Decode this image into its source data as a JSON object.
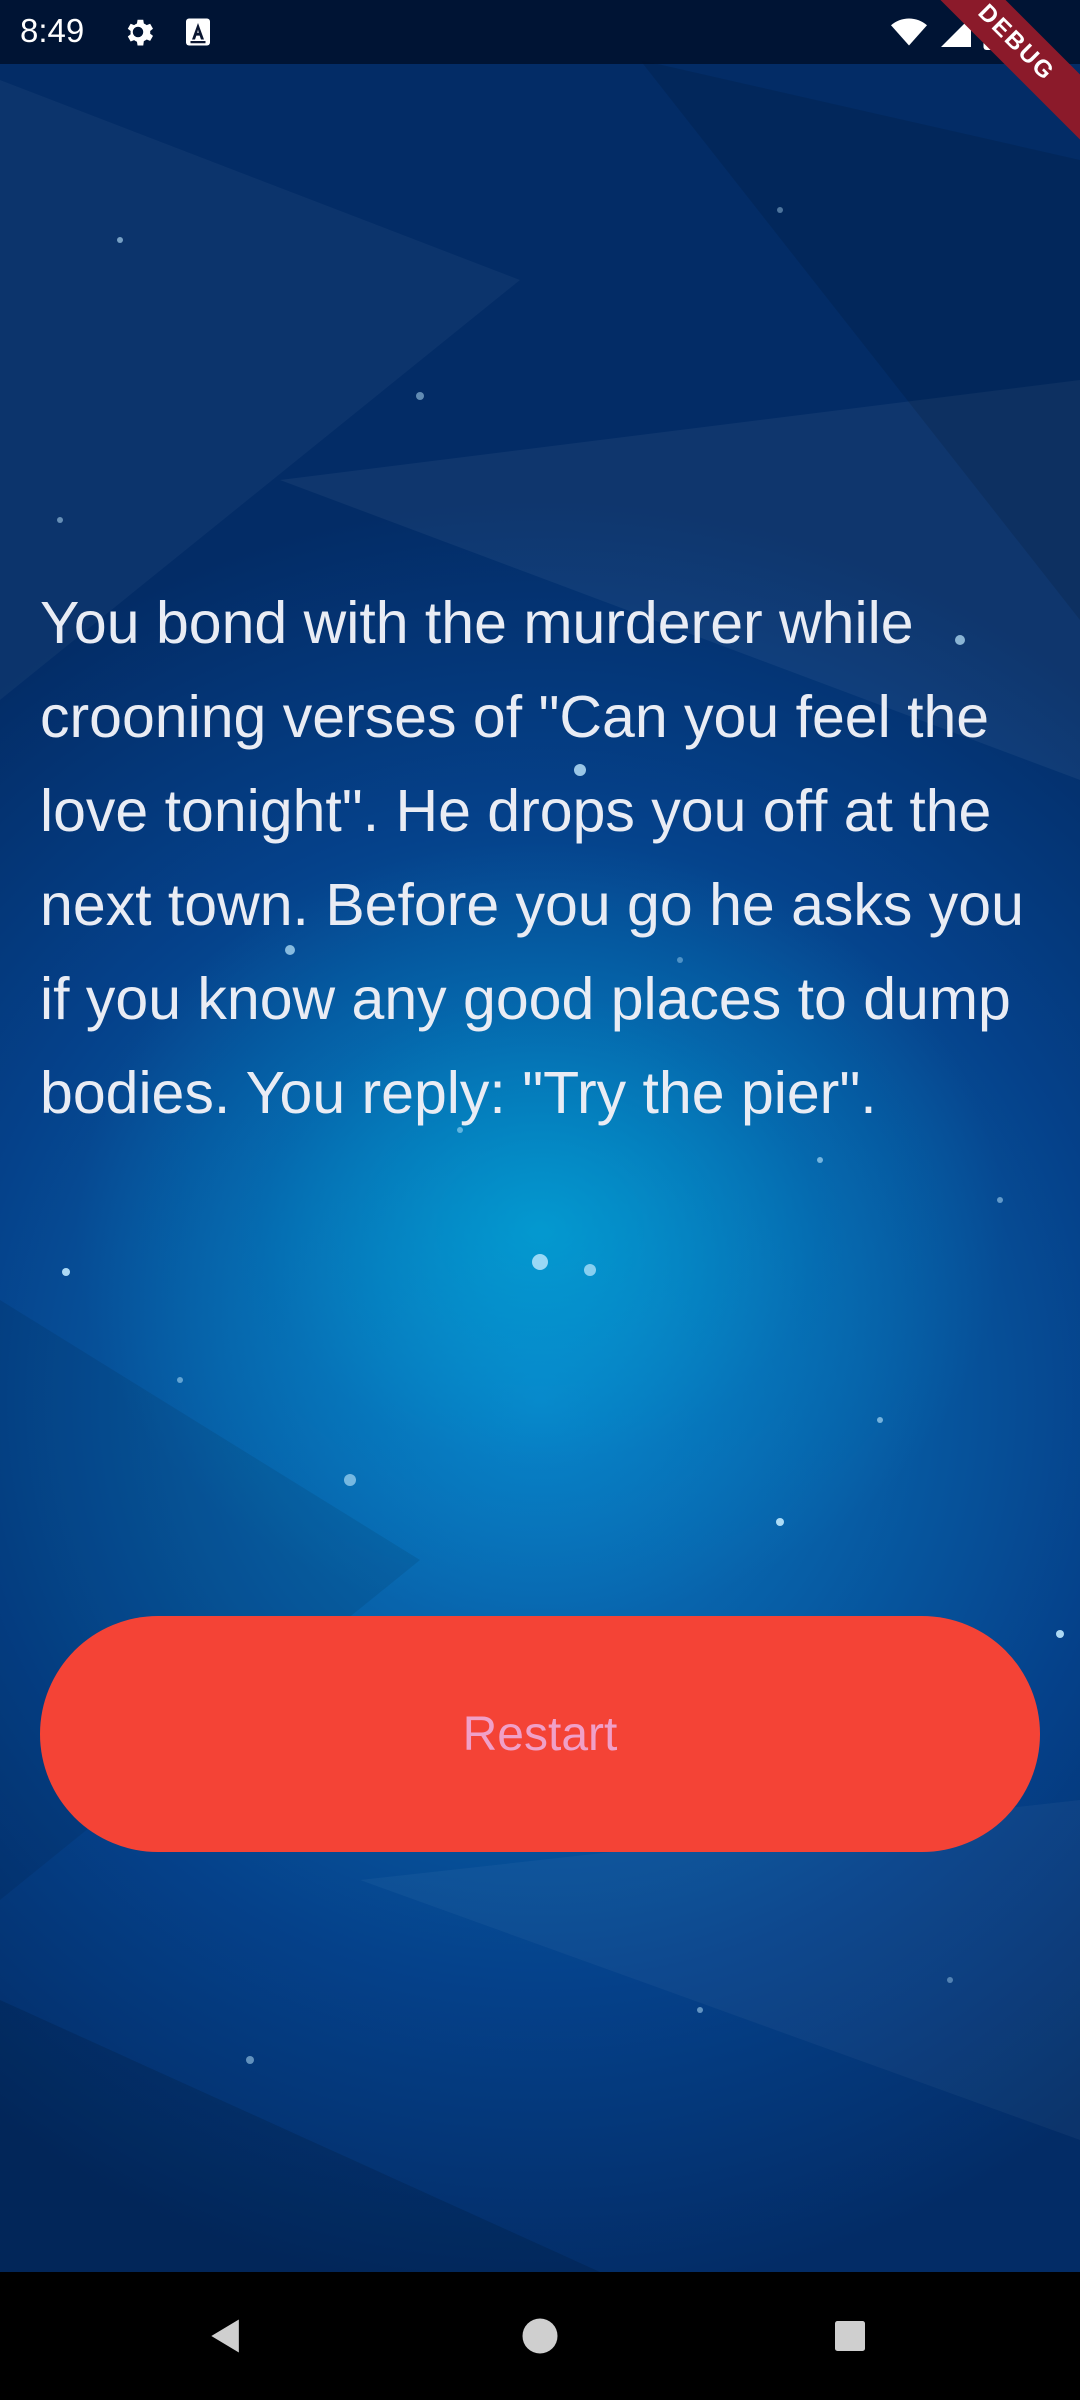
{
  "status_bar": {
    "time": "8:49",
    "icons": [
      "gear-icon",
      "font-a-icon",
      "wifi-icon",
      "signal-icon",
      "battery-icon"
    ]
  },
  "debug_banner": {
    "label": "DEBUG"
  },
  "story": {
    "text": "You bond with the murderer while crooning verses of \"Can you feel the love tonight\". He drops you off at the next town. Before you go he asks you if you know any good places to dump bodies. You reply: \"Try the pier\"."
  },
  "actions": {
    "restart_label": "Restart"
  },
  "navigation": {
    "icons": [
      "back-icon",
      "home-icon",
      "recents-icon"
    ]
  },
  "colors": {
    "button": "#f44336",
    "button_text": "#f0a0c8",
    "story_text": "#e9ecf4",
    "background": "#075ea6",
    "debug_banner": "#8b1a2a"
  }
}
